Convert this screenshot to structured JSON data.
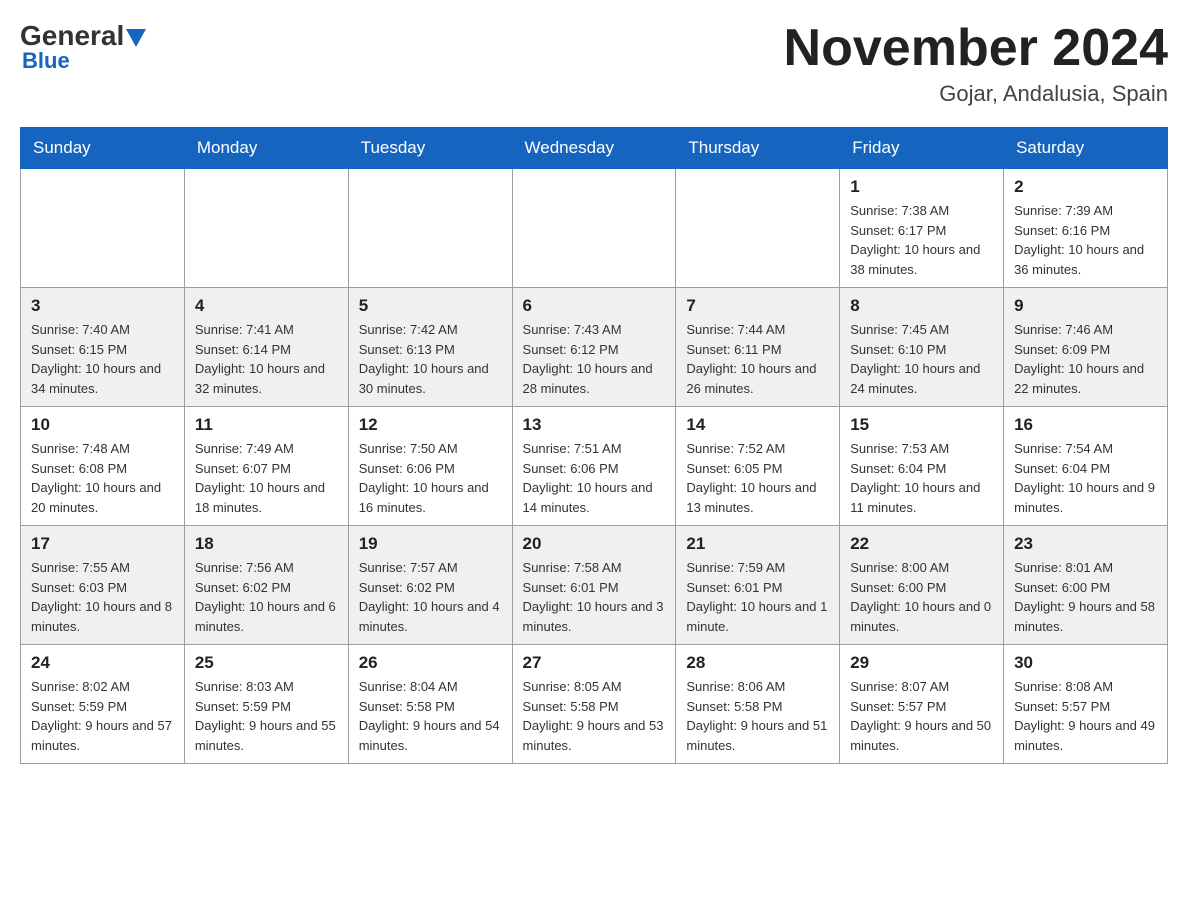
{
  "header": {
    "logo_main": "General",
    "logo_blue": "Blue",
    "month_title": "November 2024",
    "location": "Gojar, Andalusia, Spain"
  },
  "weekdays": [
    "Sunday",
    "Monday",
    "Tuesday",
    "Wednesday",
    "Thursday",
    "Friday",
    "Saturday"
  ],
  "weeks": [
    {
      "days": [
        {
          "number": "",
          "info": ""
        },
        {
          "number": "",
          "info": ""
        },
        {
          "number": "",
          "info": ""
        },
        {
          "number": "",
          "info": ""
        },
        {
          "number": "",
          "info": ""
        },
        {
          "number": "1",
          "info": "Sunrise: 7:38 AM\nSunset: 6:17 PM\nDaylight: 10 hours and 38 minutes."
        },
        {
          "number": "2",
          "info": "Sunrise: 7:39 AM\nSunset: 6:16 PM\nDaylight: 10 hours and 36 minutes."
        }
      ]
    },
    {
      "days": [
        {
          "number": "3",
          "info": "Sunrise: 7:40 AM\nSunset: 6:15 PM\nDaylight: 10 hours and 34 minutes."
        },
        {
          "number": "4",
          "info": "Sunrise: 7:41 AM\nSunset: 6:14 PM\nDaylight: 10 hours and 32 minutes."
        },
        {
          "number": "5",
          "info": "Sunrise: 7:42 AM\nSunset: 6:13 PM\nDaylight: 10 hours and 30 minutes."
        },
        {
          "number": "6",
          "info": "Sunrise: 7:43 AM\nSunset: 6:12 PM\nDaylight: 10 hours and 28 minutes."
        },
        {
          "number": "7",
          "info": "Sunrise: 7:44 AM\nSunset: 6:11 PM\nDaylight: 10 hours and 26 minutes."
        },
        {
          "number": "8",
          "info": "Sunrise: 7:45 AM\nSunset: 6:10 PM\nDaylight: 10 hours and 24 minutes."
        },
        {
          "number": "9",
          "info": "Sunrise: 7:46 AM\nSunset: 6:09 PM\nDaylight: 10 hours and 22 minutes."
        }
      ]
    },
    {
      "days": [
        {
          "number": "10",
          "info": "Sunrise: 7:48 AM\nSunset: 6:08 PM\nDaylight: 10 hours and 20 minutes."
        },
        {
          "number": "11",
          "info": "Sunrise: 7:49 AM\nSunset: 6:07 PM\nDaylight: 10 hours and 18 minutes."
        },
        {
          "number": "12",
          "info": "Sunrise: 7:50 AM\nSunset: 6:06 PM\nDaylight: 10 hours and 16 minutes."
        },
        {
          "number": "13",
          "info": "Sunrise: 7:51 AM\nSunset: 6:06 PM\nDaylight: 10 hours and 14 minutes."
        },
        {
          "number": "14",
          "info": "Sunrise: 7:52 AM\nSunset: 6:05 PM\nDaylight: 10 hours and 13 minutes."
        },
        {
          "number": "15",
          "info": "Sunrise: 7:53 AM\nSunset: 6:04 PM\nDaylight: 10 hours and 11 minutes."
        },
        {
          "number": "16",
          "info": "Sunrise: 7:54 AM\nSunset: 6:04 PM\nDaylight: 10 hours and 9 minutes."
        }
      ]
    },
    {
      "days": [
        {
          "number": "17",
          "info": "Sunrise: 7:55 AM\nSunset: 6:03 PM\nDaylight: 10 hours and 8 minutes."
        },
        {
          "number": "18",
          "info": "Sunrise: 7:56 AM\nSunset: 6:02 PM\nDaylight: 10 hours and 6 minutes."
        },
        {
          "number": "19",
          "info": "Sunrise: 7:57 AM\nSunset: 6:02 PM\nDaylight: 10 hours and 4 minutes."
        },
        {
          "number": "20",
          "info": "Sunrise: 7:58 AM\nSunset: 6:01 PM\nDaylight: 10 hours and 3 minutes."
        },
        {
          "number": "21",
          "info": "Sunrise: 7:59 AM\nSunset: 6:01 PM\nDaylight: 10 hours and 1 minute."
        },
        {
          "number": "22",
          "info": "Sunrise: 8:00 AM\nSunset: 6:00 PM\nDaylight: 10 hours and 0 minutes."
        },
        {
          "number": "23",
          "info": "Sunrise: 8:01 AM\nSunset: 6:00 PM\nDaylight: 9 hours and 58 minutes."
        }
      ]
    },
    {
      "days": [
        {
          "number": "24",
          "info": "Sunrise: 8:02 AM\nSunset: 5:59 PM\nDaylight: 9 hours and 57 minutes."
        },
        {
          "number": "25",
          "info": "Sunrise: 8:03 AM\nSunset: 5:59 PM\nDaylight: 9 hours and 55 minutes."
        },
        {
          "number": "26",
          "info": "Sunrise: 8:04 AM\nSunset: 5:58 PM\nDaylight: 9 hours and 54 minutes."
        },
        {
          "number": "27",
          "info": "Sunrise: 8:05 AM\nSunset: 5:58 PM\nDaylight: 9 hours and 53 minutes."
        },
        {
          "number": "28",
          "info": "Sunrise: 8:06 AM\nSunset: 5:58 PM\nDaylight: 9 hours and 51 minutes."
        },
        {
          "number": "29",
          "info": "Sunrise: 8:07 AM\nSunset: 5:57 PM\nDaylight: 9 hours and 50 minutes."
        },
        {
          "number": "30",
          "info": "Sunrise: 8:08 AM\nSunset: 5:57 PM\nDaylight: 9 hours and 49 minutes."
        }
      ]
    }
  ]
}
